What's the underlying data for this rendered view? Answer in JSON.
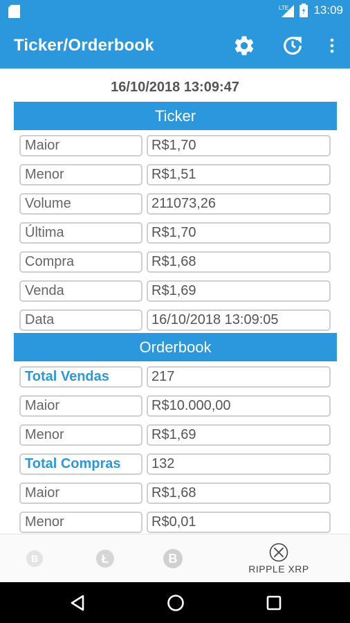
{
  "status_bar": {
    "time": "13:09",
    "network": "LTE"
  },
  "app_bar": {
    "title": "Ticker/Orderbook",
    "icons": [
      "gear-icon",
      "refresh-icon",
      "more-vert-icon"
    ]
  },
  "timestamp": "16/10/2018 13:09:47",
  "ticker": {
    "header": "Ticker",
    "rows": [
      {
        "label": "Maior",
        "value": "R$1,70"
      },
      {
        "label": "Menor",
        "value": "R$1,51"
      },
      {
        "label": "Volume",
        "value": "211073,26"
      },
      {
        "label": "Última",
        "value": "R$1,70"
      },
      {
        "label": "Compra",
        "value": "R$1,68"
      },
      {
        "label": "Venda",
        "value": "R$1,69"
      },
      {
        "label": "Data",
        "value": "16/10/2018 13:09:05"
      }
    ]
  },
  "orderbook": {
    "header": "Orderbook",
    "rows": [
      {
        "label": "Total Vendas",
        "value": "217"
      },
      {
        "label": "Maior",
        "value": "R$10.000,00"
      },
      {
        "label": "Menor",
        "value": "R$1,69"
      },
      {
        "label": "Total Compras",
        "value": "132"
      },
      {
        "label": "Maior",
        "value": "R$1,68"
      },
      {
        "label": "Menor",
        "value": "R$0,01"
      }
    ]
  },
  "bottom_nav": {
    "items": [
      {
        "icon": "bitcoin-cash-icon",
        "label": ""
      },
      {
        "icon": "litecoin-icon",
        "label": ""
      },
      {
        "icon": "bitcoin-icon",
        "label": ""
      },
      {
        "icon": "ripple-icon",
        "label": "RIPPLE XRP",
        "active": true
      }
    ]
  },
  "colors": {
    "accent": "#2b98dd",
    "border": "#cfcfcf",
    "text": "#666666"
  }
}
